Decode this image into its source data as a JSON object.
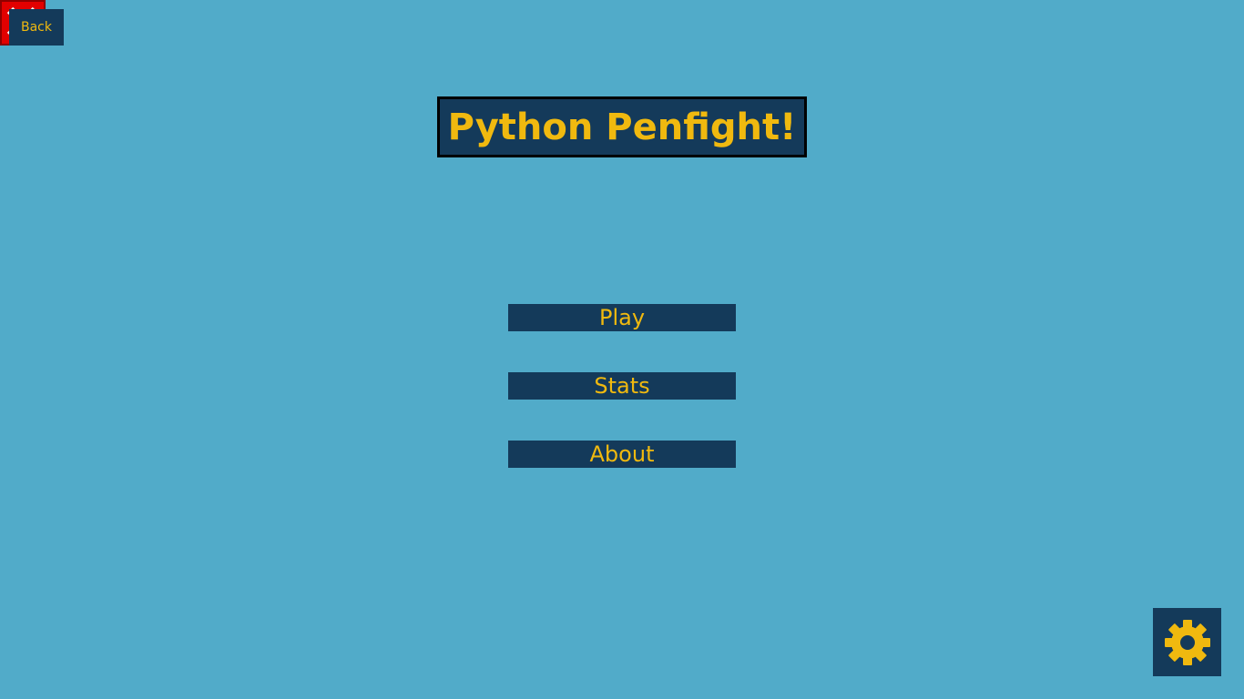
{
  "header": {
    "back_label": "Back",
    "title": "Python Penfight!"
  },
  "menu": {
    "items": [
      {
        "label": "Play"
      },
      {
        "label": "Stats"
      },
      {
        "label": "About"
      }
    ]
  },
  "icons": {
    "close": "close-icon",
    "settings": "gear-icon"
  },
  "colors": {
    "background": "#51abc9",
    "panel": "#143a5a",
    "accent": "#f0b90f",
    "close": "#e20000"
  }
}
